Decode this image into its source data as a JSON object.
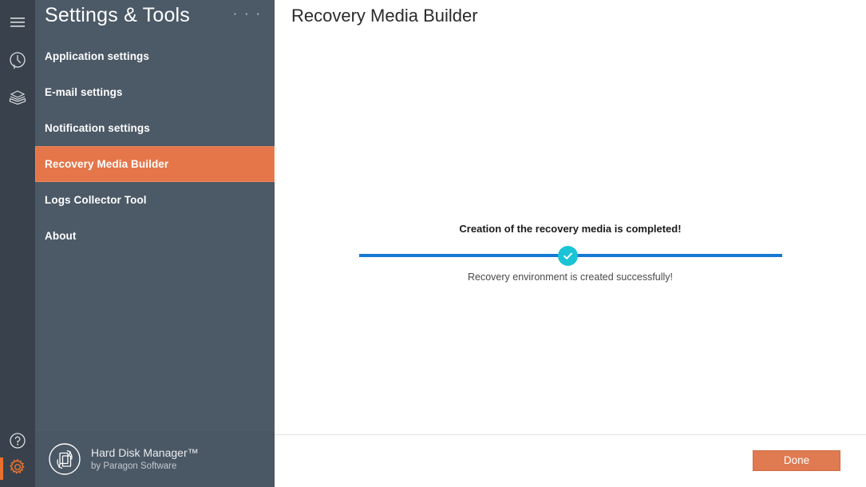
{
  "rail": {
    "icons": [
      {
        "name": "hamburger-menu-icon",
        "label": "Menu"
      },
      {
        "name": "history-clock-icon",
        "label": "History"
      },
      {
        "name": "disk-stack-icon",
        "label": "Disks"
      }
    ],
    "bottom_icons": [
      {
        "name": "help-question-icon",
        "label": "Help"
      },
      {
        "name": "settings-gear-icon",
        "label": "Settings"
      }
    ]
  },
  "sidebar": {
    "title": "Settings & Tools",
    "overflow_label": "· · ·",
    "items": [
      {
        "label": "Application settings",
        "selected": false
      },
      {
        "label": "E-mail settings",
        "selected": false
      },
      {
        "label": "Notification settings",
        "selected": false
      },
      {
        "label": "Recovery Media Builder",
        "selected": true
      },
      {
        "label": "Logs Collector Tool",
        "selected": false
      },
      {
        "label": "About",
        "selected": false
      }
    ],
    "brand": {
      "name": "Hard Disk Manager™",
      "sub": "by Paragon Software",
      "logo_icon": "paragon-circle-logo-icon"
    }
  },
  "main": {
    "title": "Recovery Media Builder",
    "progress": {
      "caption": "Creation of the recovery media is completed!",
      "subtext": "Recovery environment is created successfully!",
      "state_icon": "success-check-icon",
      "percent": 100,
      "line_color": "#1479d4",
      "check_color": "#1ac3d6"
    },
    "footer": {
      "done_label": "Done"
    }
  },
  "colors": {
    "rail_bg": "#39424c",
    "sidebar_bg": "#4c5966",
    "accent_orange": "#e4764a",
    "button_orange": "#e07a50",
    "content_bg": "#ffffff"
  }
}
